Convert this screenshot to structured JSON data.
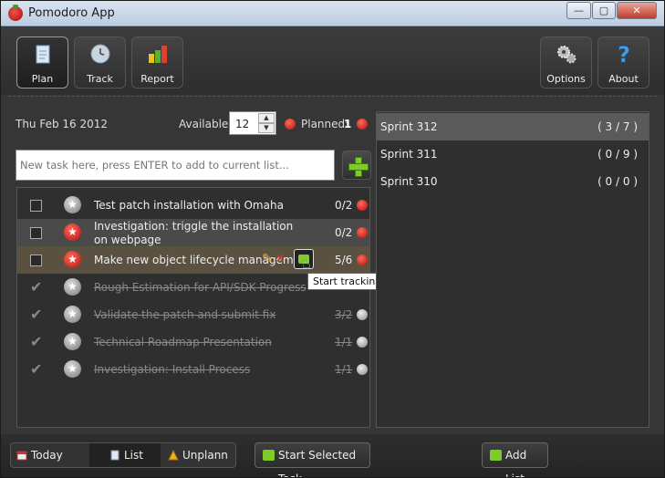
{
  "window": {
    "title": "Pomodoro App",
    "controls": {
      "minimize": "—",
      "maximize": "▢",
      "close": "✕"
    }
  },
  "toolbar": {
    "left": [
      {
        "label": "Plan",
        "icon": "notepad-icon",
        "active": true
      },
      {
        "label": "Track",
        "icon": "clock-icon",
        "active": false
      },
      {
        "label": "Report",
        "icon": "bar-chart-icon",
        "active": false
      }
    ],
    "right": [
      {
        "label": "Options",
        "icon": "gears-icon"
      },
      {
        "label": "About",
        "icon": "question-mark-icon"
      }
    ]
  },
  "plan": {
    "date": "Thu Feb 16 2012",
    "available_label": "Available:",
    "available_value": "12",
    "planned_label": "Planned:",
    "planned_value": "1",
    "task_input_placeholder": "New task here, press ENTER to add to current list..."
  },
  "tasks": [
    {
      "name": "Test patch installation with Omaha",
      "count": "0/2",
      "done": false
    },
    {
      "name": "Investigation: triggle the installation on webpage",
      "count": "0/2",
      "done": false,
      "selected": true
    },
    {
      "name": "Make new object lifecycle manageme",
      "count": "5/6",
      "done": false,
      "hover": true
    },
    {
      "name": "Rough Estimation  for API/SDK Progress",
      "count": "",
      "done": true
    },
    {
      "name": "Validate the patch and submit fix",
      "count": "3/2",
      "done": true
    },
    {
      "name": "Technical Roadmap Presentation",
      "count": "1/1",
      "done": true
    },
    {
      "name": "Investigation: Install Process",
      "count": "1/1",
      "done": true
    }
  ],
  "tooltip": "Start tracking with this task.",
  "sprints": [
    {
      "name": "Sprint 312",
      "count": "( 3 / 7 )",
      "selected": true
    },
    {
      "name": "Sprint 311",
      "count": "( 0 / 9 )",
      "selected": false
    },
    {
      "name": "Sprint 310",
      "count": "( 0 / 0 )",
      "selected": false
    }
  ],
  "bottom": {
    "today_label": "Today",
    "list_label": "List",
    "unplanned_label": "Unplann",
    "start_label": "Start Selected Task",
    "add_list_label": "Add List"
  },
  "colors": {
    "accent": "#7ecb2a",
    "tomato": "#c8191a",
    "background": "#363636"
  }
}
